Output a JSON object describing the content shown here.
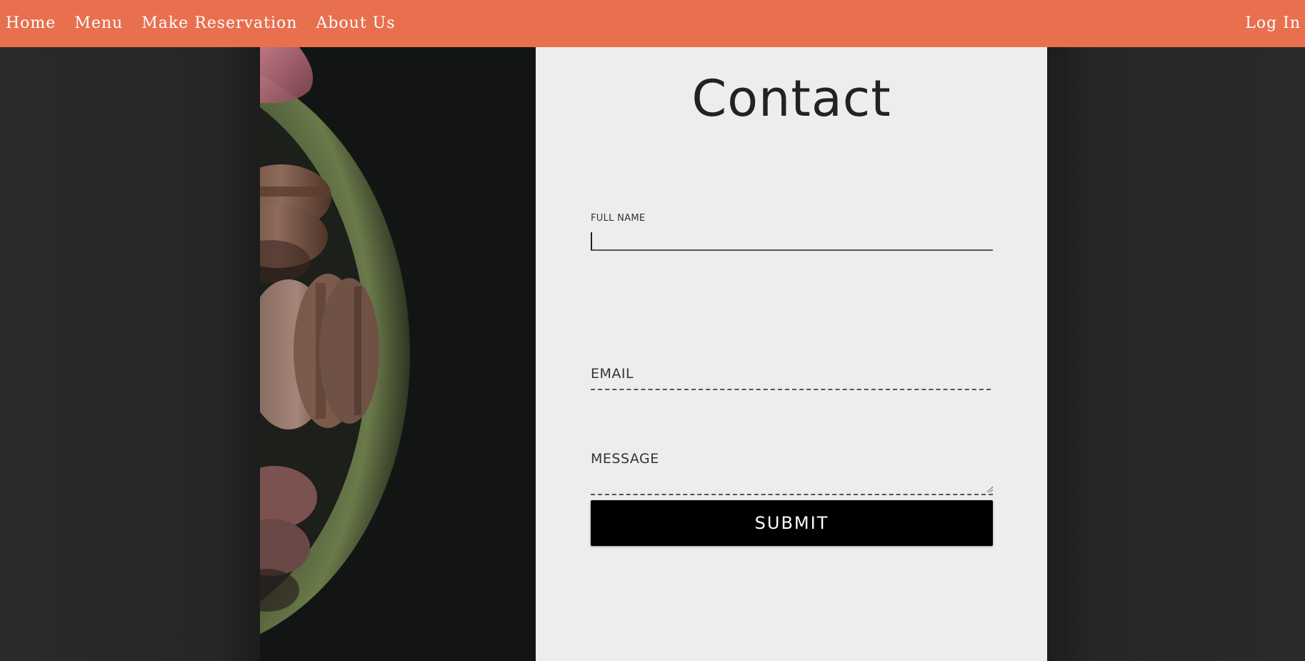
{
  "nav": {
    "items": [
      {
        "label": "Home"
      },
      {
        "label": "Menu"
      },
      {
        "label": "Make Reservation"
      },
      {
        "label": "About Us"
      }
    ],
    "login_label": "Log In"
  },
  "contact": {
    "title": "Contact",
    "full_name_label": "FULL NAME",
    "full_name_value": "",
    "email_label": "EMAIL",
    "email_value": "",
    "message_label": "MESSAGE",
    "message_value": "",
    "submit_label": "SUBMIT"
  },
  "image": {
    "subject": "macarons on a plate"
  },
  "colors": {
    "navbar": "#e8704f",
    "page_background": "#262626",
    "card_background": "#ededed",
    "button_background": "#000000",
    "button_text": "#ffffff"
  }
}
